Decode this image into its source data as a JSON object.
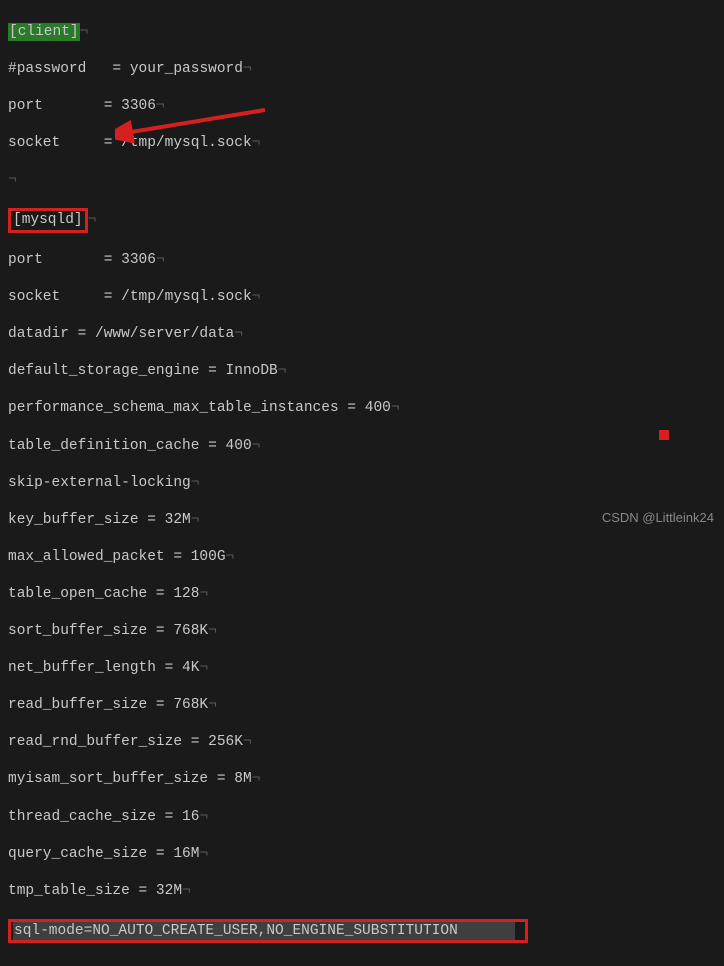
{
  "lines": {
    "l1": "[client]",
    "l2a": "#password",
    "l2b": "   = your_password",
    "l3a": "port",
    "l3b": "       = 3306",
    "l4a": "socket",
    "l4b": "     = /tmp/mysql.sock",
    "l5": "",
    "l6": "[mysqld]",
    "l7a": "port",
    "l7b": "       = 3306",
    "l8a": "socket",
    "l8b": "     = /tmp/mysql.sock",
    "l9": "datadir = /www/server/data",
    "l10": "default_storage_engine = InnoDB",
    "l11": "performance_schema_max_table_instances = 400",
    "l12": "table_definition_cache = 400",
    "l13": "skip-external-locking",
    "l14": "key_buffer_size = 32M",
    "l15": "max_allowed_packet = 100G",
    "l16": "table_open_cache = 128",
    "l17": "sort_buffer_size = 768K",
    "l18": "net_buffer_length = 4K",
    "l19": "read_buffer_size = 768K",
    "l20": "read_rnd_buffer_size = 256K",
    "l21": "myisam_sort_buffer_size = 8M",
    "l22": "thread_cache_size = 16",
    "l23": "query_cache_size = 16M",
    "l24": "tmp_table_size = 32M",
    "l25": "sql-mode=NO_AUTO_CREATE_USER,NO_ENGINE_SUBSTITUTION"
  },
  "watermark": "CSDN @Littleink24"
}
